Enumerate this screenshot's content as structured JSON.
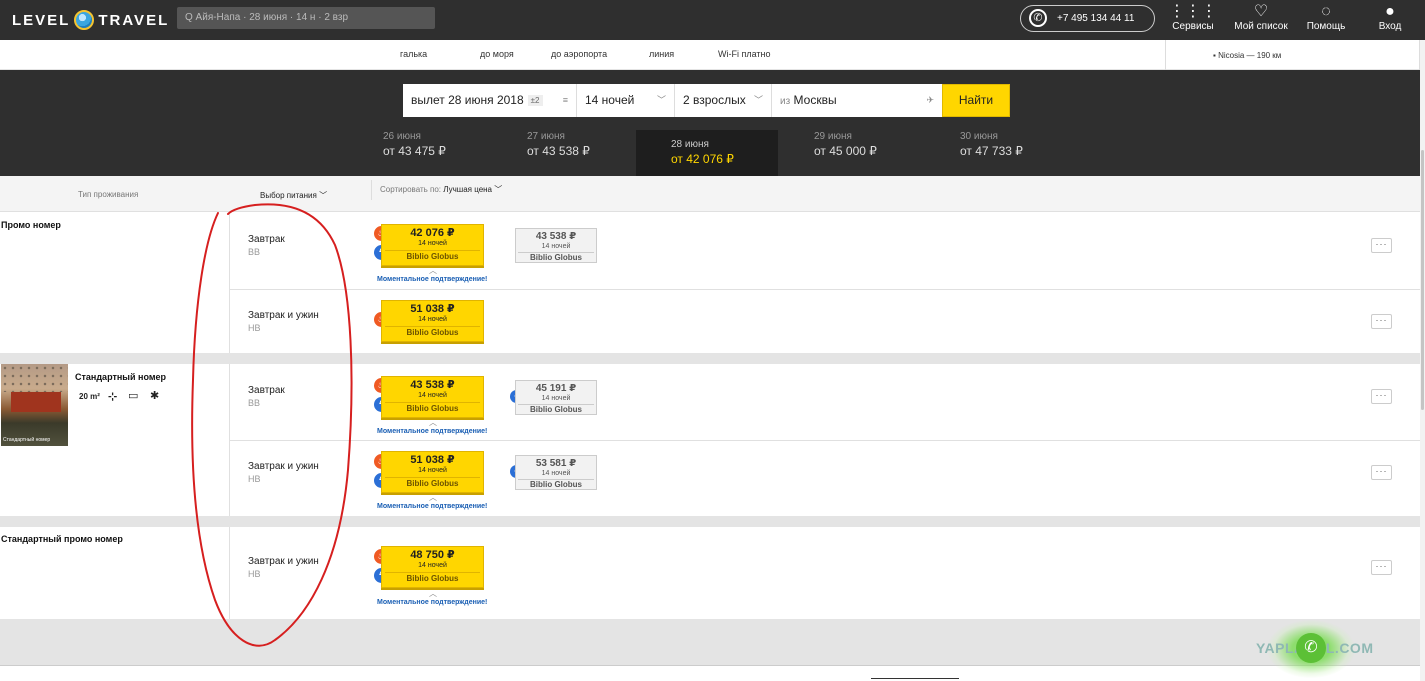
{
  "header": {
    "logo_left": "LEVEL",
    "logo_right": "TRAVEL",
    "search_text": "Q  Айя-Напа · 28 июня · 14 н · 2 взр",
    "phone": "+7 495 134 44 11",
    "nav": [
      {
        "icon": "grid-icon",
        "glyph": "⋮⋮⋮",
        "label": "Сервисы"
      },
      {
        "icon": "heart-icon",
        "glyph": "♡",
        "label": "Мой список"
      },
      {
        "icon": "lightbulb-icon",
        "glyph": "◌",
        "label": "Помощь"
      },
      {
        "icon": "user-icon",
        "glyph": "●",
        "label": "Вход"
      }
    ]
  },
  "amenities": [
    "галька",
    "до моря",
    "до аэропорта",
    "линия",
    "Wi-Fi платно"
  ],
  "side_distance": "Nicosia — 190 км",
  "search": {
    "date": "вылет 28 июня 2018",
    "date_flex": "±2",
    "nights": "14 ночей",
    "guests": "2 взрослых",
    "from_prefix": "из",
    "from": "Москвы",
    "submit": "Найти"
  },
  "days": [
    {
      "date": "26 июня",
      "price": "от 43 475 ₽"
    },
    {
      "date": "27 июня",
      "price": "от 43 538 ₽"
    },
    {
      "date": "28 июня",
      "price": "от 42 076 ₽"
    },
    {
      "date": "29 июня",
      "price": "от 45 000 ₽"
    },
    {
      "date": "30 июня",
      "price": "от 47 733 ₽"
    }
  ],
  "table_header": {
    "col_room": "Тип проживания",
    "col_meal": "Выбор питания",
    "sort_label": "Сортировать по:",
    "sort_value": "Лучшая цена"
  },
  "instant_text": "Моментальное подтверждение!",
  "rooms": [
    {
      "title": "Промо номер",
      "rows": [
        {
          "meal": "Завтрак",
          "code": "BB",
          "offer": {
            "price": "42 076 ₽",
            "nights": "14 ночей",
            "operator": "Biblio Globus"
          },
          "alt": {
            "price": "43 538 ₽",
            "nights": "14 ночей",
            "operator": "Biblio Globus"
          }
        },
        {
          "meal": "Завтрак и ужин",
          "code": "HB",
          "offer": {
            "price": "51 038 ₽",
            "nights": "14 ночей",
            "operator": "Biblio Globus"
          }
        }
      ]
    },
    {
      "title": "Стандартный номер",
      "area": "20 m²",
      "photo_caption": "Стандартный номер",
      "rows": [
        {
          "meal": "Завтрак",
          "code": "BB",
          "offer": {
            "price": "43 538 ₽",
            "nights": "14 ночей",
            "operator": "Biblio Globus"
          },
          "alt": {
            "price": "45 191 ₽",
            "nights": "14 ночей",
            "operator": "Biblio Globus"
          }
        },
        {
          "meal": "Завтрак и ужин",
          "code": "HB",
          "offer": {
            "price": "51 038 ₽",
            "nights": "14 ночей",
            "operator": "Biblio Globus"
          },
          "alt": {
            "price": "53 581 ₽",
            "nights": "14 ночей",
            "operator": "Biblio Globus"
          }
        }
      ]
    },
    {
      "title": "Стандартный промо номер",
      "rows": [
        {
          "meal": "Завтрак и ужин",
          "code": "HB",
          "offer": {
            "price": "48 750 ₽",
            "nights": "14 ночей",
            "operator": "Biblio Globus"
          }
        }
      ]
    }
  ],
  "watermark": "YAPLAKAL.COM",
  "colors": {
    "accent": "#ffd600",
    "dark": "#2f2f2f",
    "annotation": "#d61f1f"
  }
}
